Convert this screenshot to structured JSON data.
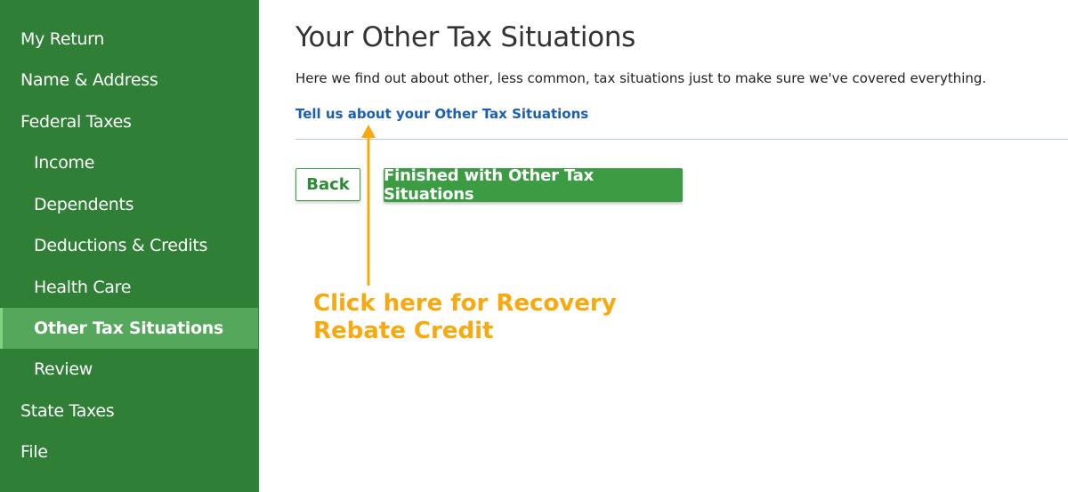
{
  "sidebar": {
    "items": [
      {
        "label": "My Return",
        "level": "top",
        "active": false
      },
      {
        "label": "Name & Address",
        "level": "top",
        "active": false
      },
      {
        "label": "Federal Taxes",
        "level": "top",
        "active": false
      },
      {
        "label": "Income",
        "level": "sub",
        "active": false
      },
      {
        "label": "Dependents",
        "level": "sub",
        "active": false
      },
      {
        "label": "Deductions & Credits",
        "level": "sub",
        "active": false
      },
      {
        "label": "Health Care",
        "level": "sub",
        "active": false
      },
      {
        "label": "Other Tax Situations",
        "level": "sub",
        "active": true
      },
      {
        "label": "Review",
        "level": "sub",
        "active": false
      },
      {
        "label": "State Taxes",
        "level": "top",
        "active": false
      },
      {
        "label": "File",
        "level": "top",
        "active": false
      }
    ]
  },
  "main": {
    "title": "Your Other Tax Situations",
    "description": "Here we find out about other, less common, tax situations just to make sure we've covered everything.",
    "link_label": "Tell us about your Other Tax Situations",
    "back_label": "Back",
    "finish_label": "Finished with Other Tax Situations"
  },
  "annotation": {
    "text": "Click here for Recovery Rebate Credit",
    "color": "#f7a90e"
  },
  "colors": {
    "sidebar_bg": "#2f7f36",
    "sidebar_active": "#55a75c",
    "primary_button": "#3c9c44",
    "link": "#1a5fb4"
  }
}
